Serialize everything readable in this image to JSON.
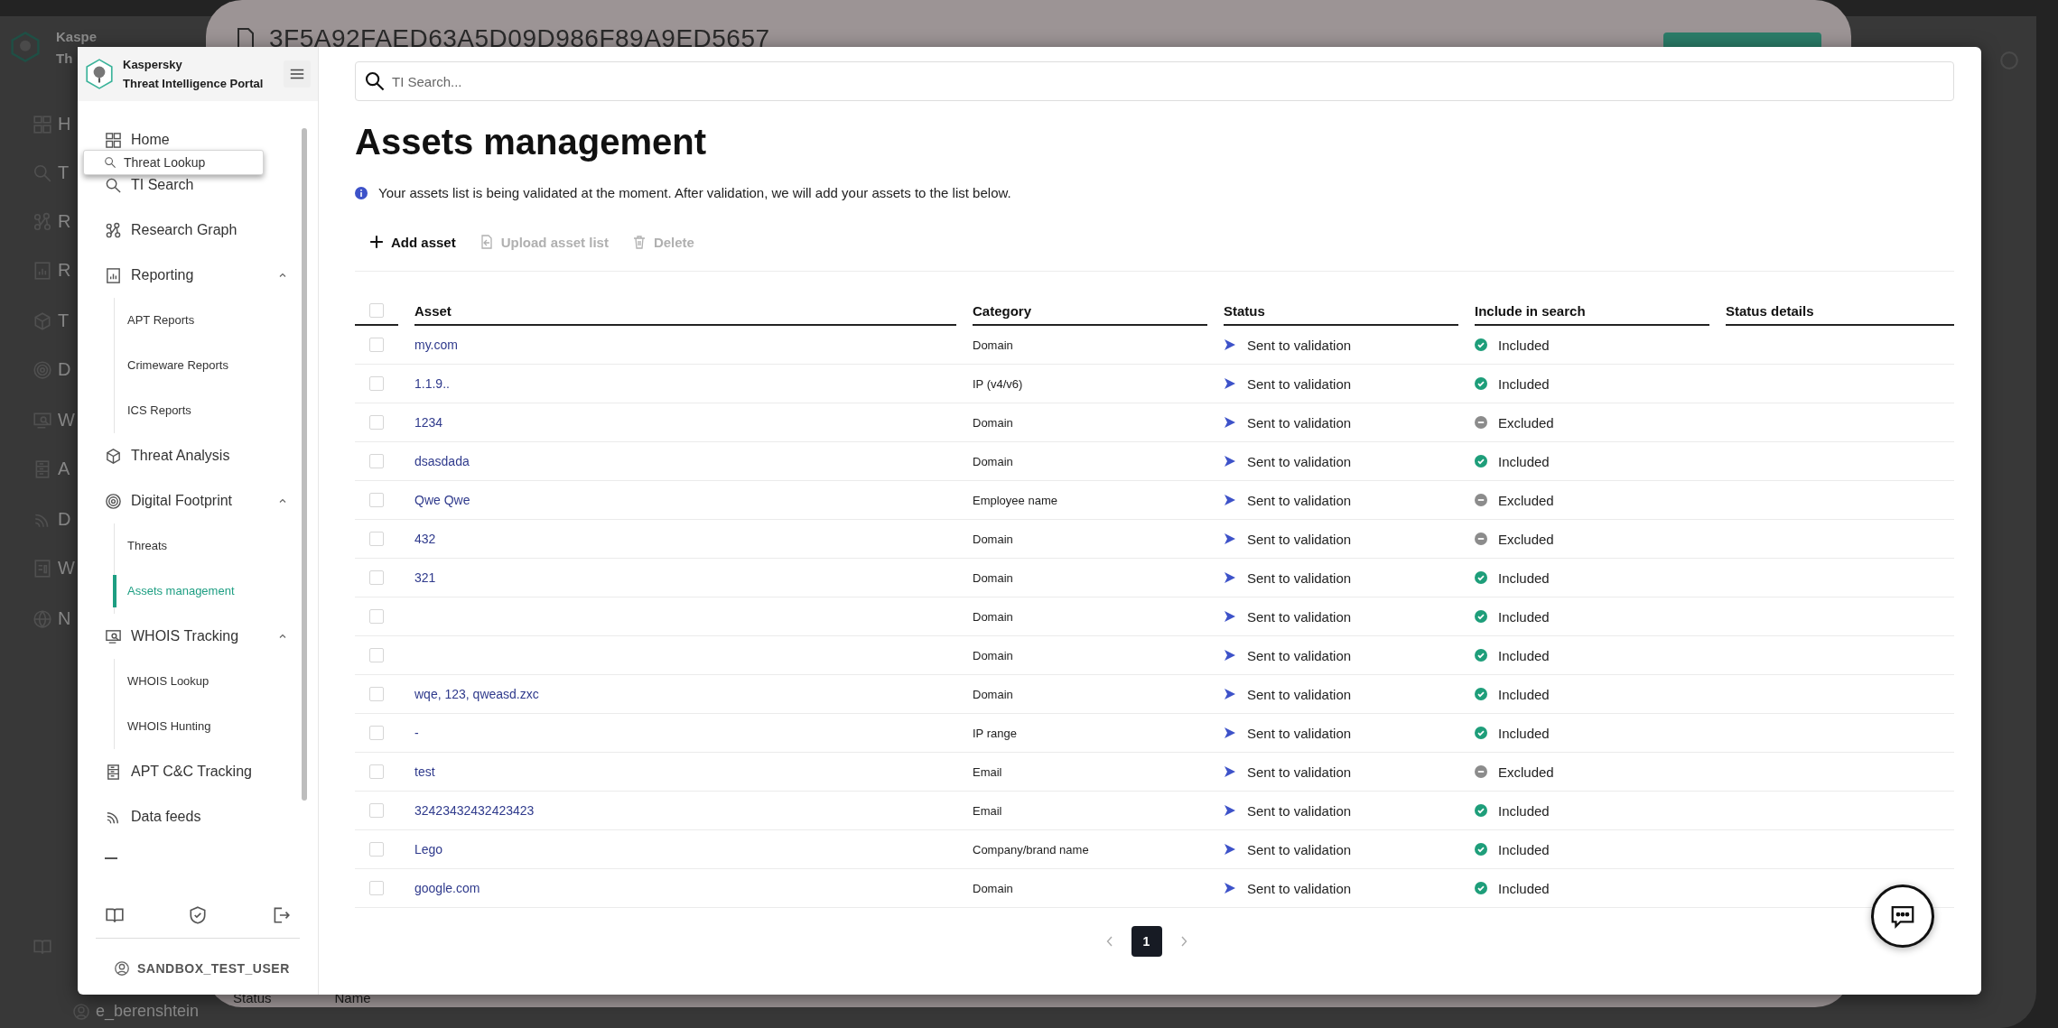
{
  "background_app": {
    "brand": [
      "Kaspe",
      "Th"
    ],
    "nav_letters": [
      "H",
      "T",
      "R",
      "R",
      "T",
      "D",
      "W",
      "A",
      "D",
      "W",
      "N"
    ],
    "user": "e_berenshtein",
    "file_title": "3F5A92FAED63A5D09D986F89A9ED5657",
    "footer_texts": [
      "Status",
      "Name"
    ]
  },
  "sidebar": {
    "brand": "Kaspersky",
    "product": "Threat Intelligence Portal",
    "items": [
      {
        "label": "Home"
      },
      {
        "label": "TI Search"
      },
      {
        "label": "Research Graph"
      },
      {
        "label": "Reporting",
        "expanded": true,
        "children": [
          {
            "label": "APT Reports",
            "selected": false
          },
          {
            "label": "Crimeware Reports",
            "selected": false
          },
          {
            "label": "ICS Reports",
            "selected": false
          }
        ]
      },
      {
        "label": "Threat Analysis"
      },
      {
        "label": "Digital Footprint",
        "expanded": true,
        "children": [
          {
            "label": "Threats",
            "selected": false
          },
          {
            "label": "Assets management",
            "selected": true
          }
        ]
      },
      {
        "label": "WHOIS Tracking",
        "expanded": true,
        "children": [
          {
            "label": "WHOIS Lookup",
            "selected": false
          },
          {
            "label": "WHOIS Hunting",
            "selected": false
          }
        ]
      },
      {
        "label": "APT C&C Tracking"
      },
      {
        "label": "Data feeds"
      }
    ],
    "user": "SANDBOX_TEST_USER"
  },
  "tooltip": "Threat Lookup",
  "search": {
    "placeholder": "TI Search..."
  },
  "page": {
    "title": "Assets management",
    "notice": "Your assets list is being validated at the moment. After validation, we will add your assets to the list below.",
    "toolbar": [
      {
        "label": "Add asset",
        "disabled": false
      },
      {
        "label": "Upload asset list",
        "disabled": true
      },
      {
        "label": "Delete",
        "disabled": true
      }
    ]
  },
  "table": {
    "all_checked": false,
    "columns": [
      "Asset",
      "Category",
      "Status",
      "Include in search",
      "Status details"
    ],
    "rows": [
      {
        "checked": false,
        "asset": "my.com",
        "category": "Domain",
        "status": "Sent to validation",
        "included": true,
        "include_label": "Included"
      },
      {
        "checked": false,
        "asset": "1.1.9..",
        "category": "IP (v4/v6)",
        "status": "Sent to validation",
        "included": true,
        "include_label": "Included"
      },
      {
        "checked": false,
        "asset": "1234",
        "category": "Domain",
        "status": "Sent to validation",
        "included": false,
        "include_label": "Excluded"
      },
      {
        "checked": false,
        "asset": "dsasdada",
        "category": "Domain",
        "status": "Sent to validation",
        "included": true,
        "include_label": "Included"
      },
      {
        "checked": false,
        "asset": "Qwe Qwe",
        "category": "Employee name",
        "status": "Sent to validation",
        "included": false,
        "include_label": "Excluded"
      },
      {
        "checked": false,
        "asset": "432",
        "category": "Domain",
        "status": "Sent to validation",
        "included": false,
        "include_label": "Excluded"
      },
      {
        "checked": false,
        "asset": "321",
        "category": "Domain",
        "status": "Sent to validation",
        "included": true,
        "include_label": "Included"
      },
      {
        "checked": false,
        "category": "Domain",
        "status": "Sent to validation",
        "included": true,
        "include_label": "Included"
      },
      {
        "checked": false,
        "category": "Domain",
        "status": "Sent to validation",
        "included": true,
        "include_label": "Included"
      },
      {
        "checked": false,
        "asset": "wqe, 123, qweasd.zxc",
        "category": "Domain",
        "status": "Sent to validation",
        "included": true,
        "include_label": "Included"
      },
      {
        "checked": false,
        "asset": "-",
        "category": "IP range",
        "status": "Sent to validation",
        "included": true,
        "include_label": "Included"
      },
      {
        "checked": false,
        "asset": "test",
        "category": "Email",
        "status": "Sent to validation",
        "included": false,
        "include_label": "Excluded"
      },
      {
        "checked": false,
        "asset": "32423432432423423",
        "category": "Email",
        "status": "Sent to validation",
        "included": true,
        "include_label": "Included"
      },
      {
        "checked": false,
        "asset": "Lego",
        "category": "Company/brand name",
        "status": "Sent to validation",
        "included": true,
        "include_label": "Included"
      },
      {
        "checked": false,
        "asset": "google.com",
        "category": "Domain",
        "status": "Sent to validation",
        "included": true,
        "include_label": "Included"
      }
    ]
  },
  "pagination": {
    "pages": [
      {
        "label": "1",
        "selected": true
      }
    ]
  }
}
